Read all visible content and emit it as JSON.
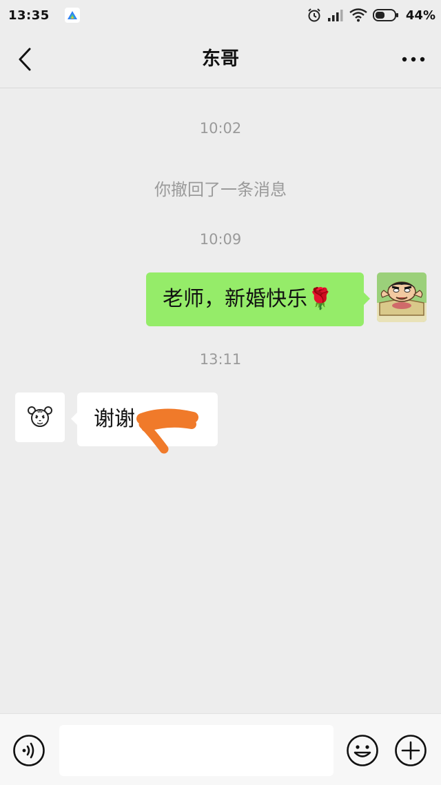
{
  "status_bar": {
    "time": "13:35",
    "battery": "44%",
    "icons": [
      "app-notification-icon",
      "alarm-icon",
      "signal-icon",
      "wifi-icon",
      "battery-icon"
    ]
  },
  "nav": {
    "title": "东哥",
    "back_icon": "chevron-left-icon",
    "more_icon": "more-dots-icon"
  },
  "chat": {
    "timestamp_1": "10:02",
    "recall_notice": "你撤回了一条消息",
    "timestamp_2": "10:09",
    "outgoing_message": "老师，新婚快乐🌹",
    "timestamp_3": "13:11",
    "incoming_message_visible": "谢谢",
    "incoming_message_tail": "!"
  },
  "input_bar": {
    "text_value": "",
    "icons": [
      "voice-icon",
      "emoji-icon",
      "plus-icon"
    ]
  },
  "colors": {
    "background": "#ededed",
    "outgoing_bubble": "#95ec69",
    "incoming_bubble": "#ffffff",
    "redaction_scribble": "#f07a2a",
    "meta_text": "#9a9a9a"
  }
}
